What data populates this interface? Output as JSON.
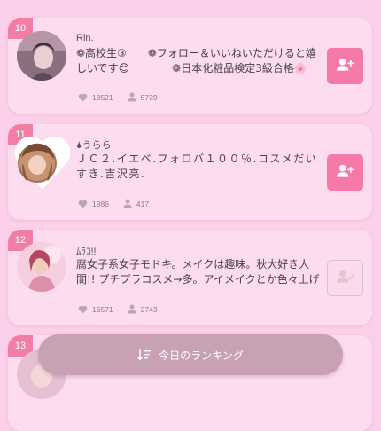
{
  "entries": [
    {
      "rank": "10",
      "name": "Rin.",
      "bio": "❁高校生③　　❁フォロー＆いいねいただけると嬉しいです😊　　　　❁日本化粧品検定3級合格🌸",
      "likes": "18521",
      "followers": "5739",
      "followed": false
    },
    {
      "rank": "11",
      "name": "🌢うらら",
      "bio": "ＪＣ２.イエベ.フォロバ１００％.コスメだいすき.吉沢亮.",
      "likes": "1986",
      "followers": "417",
      "followed": false
    },
    {
      "rank": "12",
      "name": "ﾑﾗｺ!!",
      "bio": "腐女子系女子モドキ。メイクは趣味。秋大好き人間!! プチプラコスメ→多。アイメイクとか色々上げてま...",
      "likes": "16571",
      "followers": "2743",
      "followed": true
    },
    {
      "rank": "13"
    }
  ],
  "bottom_button": {
    "label": "今日のランキング"
  },
  "colors": {
    "background": "#fcd0ea",
    "card": "#fddcef",
    "accent": "#f27ea6",
    "follow_button": "#f57aa8",
    "bottom_button": "#c9a1b5"
  },
  "icons": {
    "likes": "heart-icon",
    "followers": "person-icon",
    "follow": "add-user-icon",
    "followed": "user-check-icon",
    "ranking": "sort-icon"
  }
}
